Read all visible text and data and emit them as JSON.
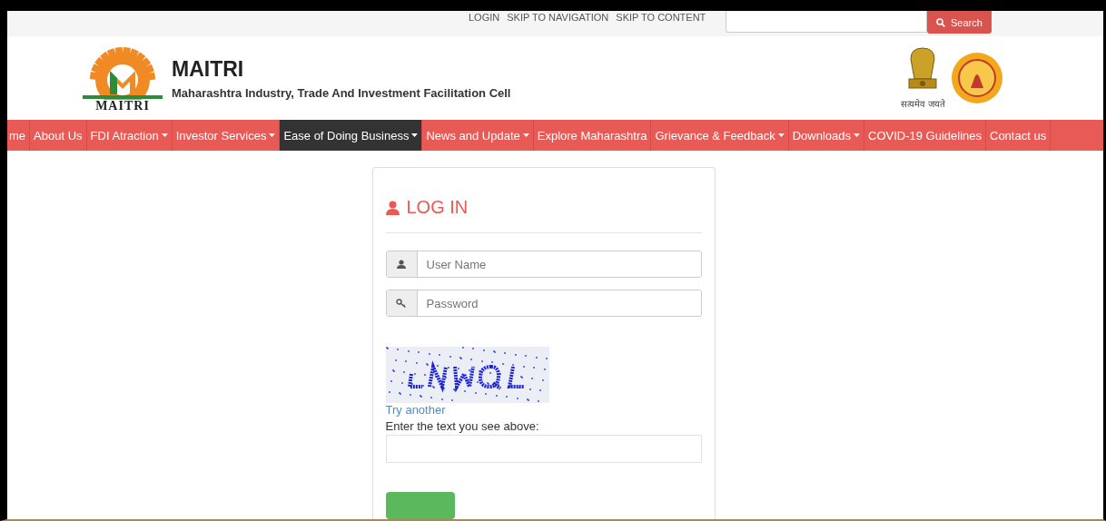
{
  "top_links": [
    "LOGIN",
    "SKIP TO NAVIGATION",
    "SKIP TO CONTENT"
  ],
  "search": {
    "button": "Search"
  },
  "header": {
    "logo_caption": "MAITRI",
    "title": "MAITRI",
    "subtitle": "Maharashtra Industry, Trade And Investment Facilitation Cell",
    "emblem_caption": "सत्यमेव जयते"
  },
  "nav": [
    {
      "label": "me",
      "caret": false,
      "selected": false
    },
    {
      "label": "About Us",
      "caret": false,
      "selected": false
    },
    {
      "label": "FDI Atraction",
      "caret": true,
      "selected": false
    },
    {
      "label": "Investor Services",
      "caret": true,
      "selected": false
    },
    {
      "label": "Ease of Doing Business",
      "caret": true,
      "selected": true
    },
    {
      "label": "News and Update",
      "caret": true,
      "selected": false
    },
    {
      "label": "Explore Maharashtra",
      "caret": false,
      "selected": false
    },
    {
      "label": "Grievance & Feedback",
      "caret": true,
      "selected": false
    },
    {
      "label": "Downloads",
      "caret": true,
      "selected": false
    },
    {
      "label": "COVID-19 Guidelines",
      "caret": false,
      "selected": false
    },
    {
      "label": "Contact us",
      "caret": false,
      "selected": false
    }
  ],
  "login": {
    "title": "LOG IN",
    "fields": [
      {
        "kind": "user",
        "placeholder": "User Name"
      },
      {
        "kind": "password",
        "placeholder": "Password"
      }
    ],
    "captcha_link": "Try another",
    "captcha_label": "Enter the text you see above:"
  }
}
